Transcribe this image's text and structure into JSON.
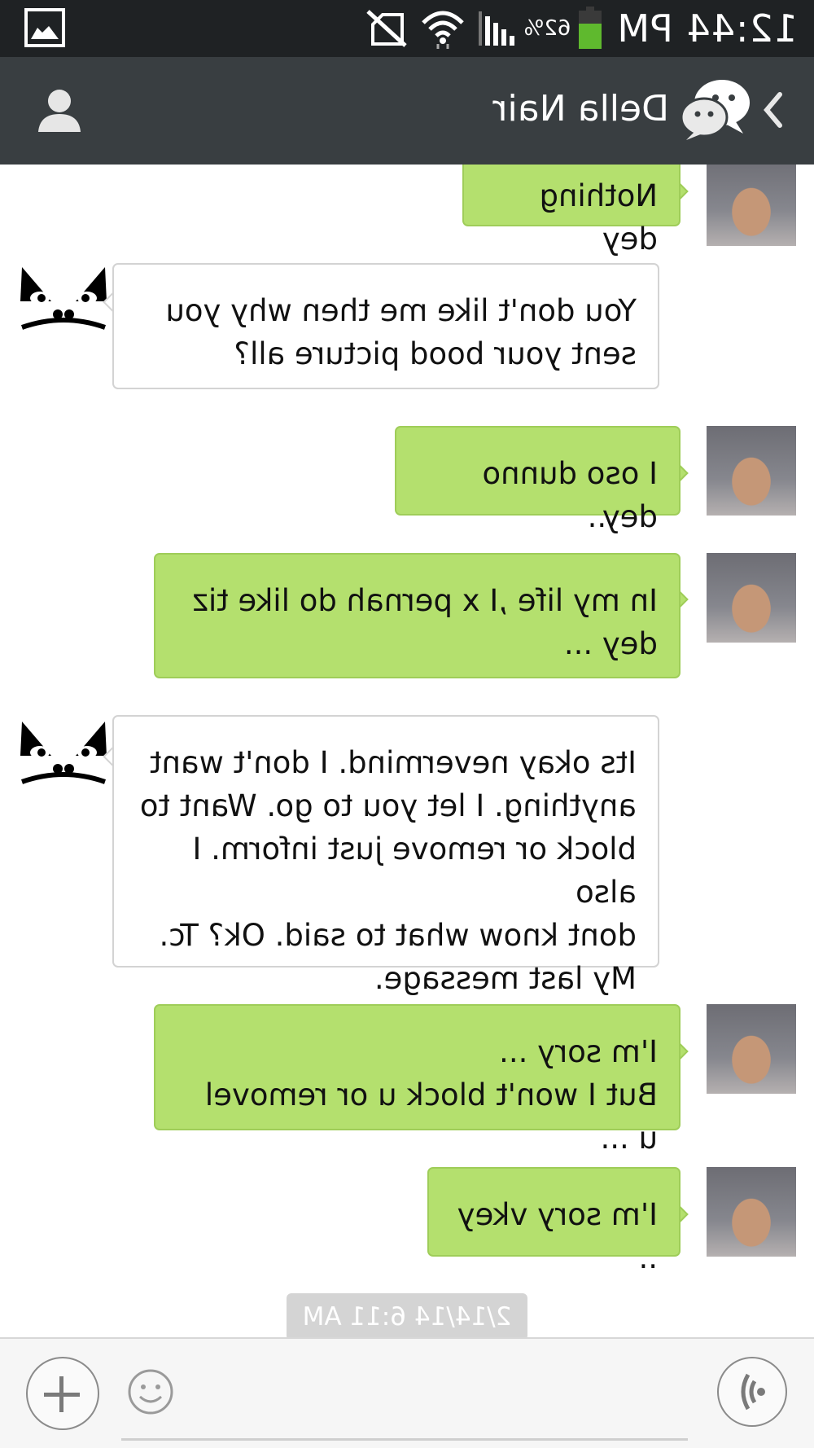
{
  "status_bar": {
    "time": "12:44 PM",
    "battery_percent": "62%",
    "battery_level": 0.62,
    "icons": [
      "battery-icon",
      "signal-icon",
      "wifi-icon",
      "no-sim-icon",
      "gallery-notification-icon"
    ]
  },
  "header": {
    "title": "Della Nair",
    "icons": [
      "back-chevron-icon",
      "wechat-logo-icon",
      "contact-profile-icon"
    ]
  },
  "messages": [
    {
      "sender": "me",
      "avatar": "girl",
      "text": "Nothing dey"
    },
    {
      "sender": "other",
      "avatar": "angry-face",
      "text": "You don't like me then why you\nsent your bood picture all?"
    },
    {
      "sender": "me",
      "avatar": "girl",
      "text": "I oso dunno dey.."
    },
    {
      "sender": "me",
      "avatar": "girl",
      "text": "In my life ,I x pernah do like tiz\ndey ..."
    },
    {
      "sender": "other",
      "avatar": "angry-face",
      "text": "Its okay nevermind. I don't want\nanything. I let you to go. Want to\nblock or remove just inform. I also\ndont know what to said. Ok? Tc.\nMy last message."
    },
    {
      "sender": "me",
      "avatar": "girl",
      "text": "I'm sory ...\nBut I won't block u or removel u ..."
    },
    {
      "sender": "me",
      "avatar": "girl",
      "text": "I'm sory vkey .."
    }
  ],
  "timestamp": "2/14/14 6:11 AM",
  "input_bar": {
    "placeholder": "",
    "icons": [
      "voice-icon",
      "emoji-icon",
      "plus-icon"
    ]
  },
  "colors": {
    "status_bar": "#1f2224",
    "header": "#393e41",
    "sent_bubble": "#b4e06e",
    "received_bubble": "#ffffff",
    "battery_fill": "#5fb92e"
  }
}
